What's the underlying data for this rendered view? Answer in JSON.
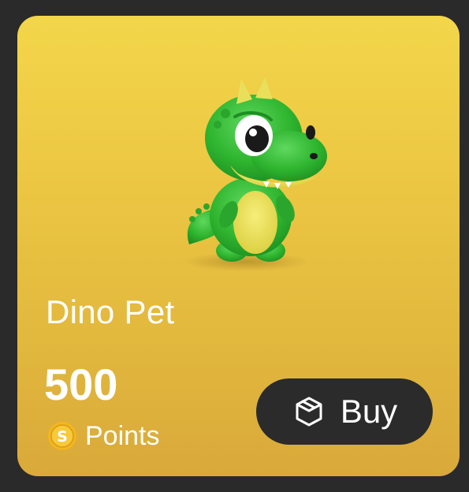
{
  "product": {
    "name": "Dino Pet",
    "image_icon": "dino-pet-icon",
    "price": "500",
    "currency_label": "Points",
    "currency_icon": "coin-icon",
    "coin_symbol": "S"
  },
  "actions": {
    "buy_label": "Buy",
    "buy_icon": "shopping-bag-icon"
  },
  "colors": {
    "card_gradient_top": "#f3d64a",
    "card_gradient_bottom": "#d9a93a",
    "button_bg": "#2b2b2b",
    "text": "#ffffff",
    "coin": "#f3b61f"
  }
}
